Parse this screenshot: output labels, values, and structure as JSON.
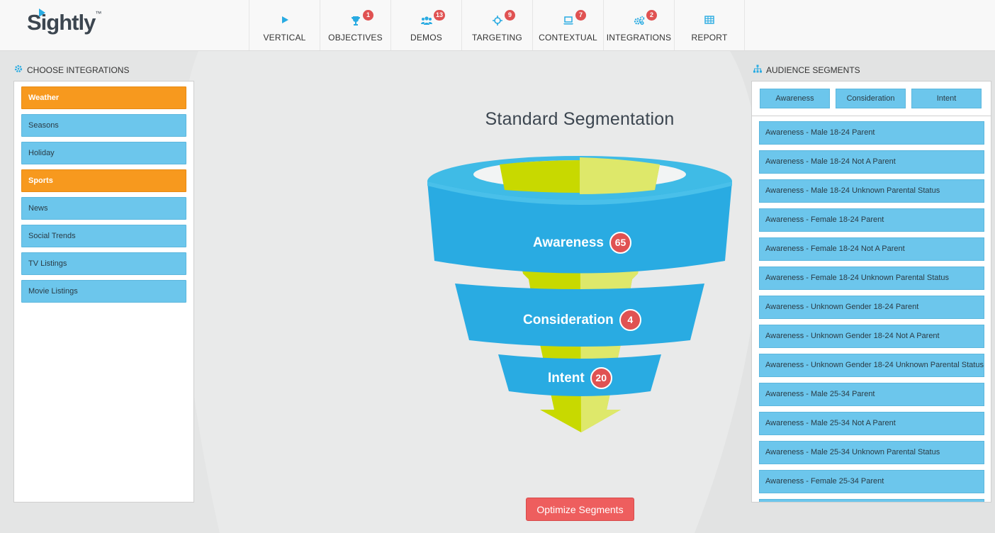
{
  "brand": {
    "name": "Sightly",
    "tm": "™"
  },
  "nav": [
    {
      "label": "VERTICAL",
      "icon": "play-icon",
      "badge": ""
    },
    {
      "label": "OBJECTIVES",
      "icon": "trophy-icon",
      "badge": "1"
    },
    {
      "label": "DEMOS",
      "icon": "users-icon",
      "badge": "13"
    },
    {
      "label": "TARGETING",
      "icon": "crosshairs-icon",
      "badge": "9"
    },
    {
      "label": "CONTEXTUAL",
      "icon": "laptop-icon",
      "badge": "7"
    },
    {
      "label": "INTEGRATIONS",
      "icon": "cogs-icon",
      "badge": "2"
    },
    {
      "label": "REPORT",
      "icon": "table-icon",
      "badge": ""
    }
  ],
  "integrations": {
    "heading": "CHOOSE INTEGRATIONS",
    "items": [
      {
        "label": "Weather",
        "active": true
      },
      {
        "label": "Seasons",
        "active": false
      },
      {
        "label": "Holiday",
        "active": false
      },
      {
        "label": "Sports",
        "active": true
      },
      {
        "label": "News",
        "active": false
      },
      {
        "label": "Social Trends",
        "active": false
      },
      {
        "label": "TV Listings",
        "active": false
      },
      {
        "label": "Movie Listings",
        "active": false
      }
    ]
  },
  "funnel": {
    "title": "Standard Segmentation",
    "stages": [
      {
        "label": "Awareness",
        "count": "65"
      },
      {
        "label": "Consideration",
        "count": "4"
      },
      {
        "label": "Intent",
        "count": "20"
      }
    ],
    "colors": {
      "ring": "#29abe2",
      "arrow": "#c8d900"
    }
  },
  "audience": {
    "heading": "AUDIENCE SEGMENTS",
    "tabs": [
      "Awareness",
      "Consideration",
      "Intent"
    ],
    "segments": [
      "Awareness - Male 18-24 Parent",
      "Awareness - Male 18-24 Not A Parent",
      "Awareness - Male 18-24 Unknown Parental Status",
      "Awareness - Female 18-24 Parent",
      "Awareness - Female 18-24 Not A Parent",
      "Awareness - Female 18-24 Unknown Parental Status",
      "Awareness - Unknown Gender 18-24 Parent",
      "Awareness - Unknown Gender 18-24 Not A Parent",
      "Awareness - Unknown Gender 18-24 Unknown Parental Status",
      "Awareness - Male 25-34 Parent",
      "Awareness - Male 25-34 Not A Parent",
      "Awareness - Male 25-34 Unknown Parental Status",
      "Awareness - Female 25-34 Parent",
      ""
    ]
  },
  "actions": {
    "optimize_label": "Optimize Segments"
  }
}
